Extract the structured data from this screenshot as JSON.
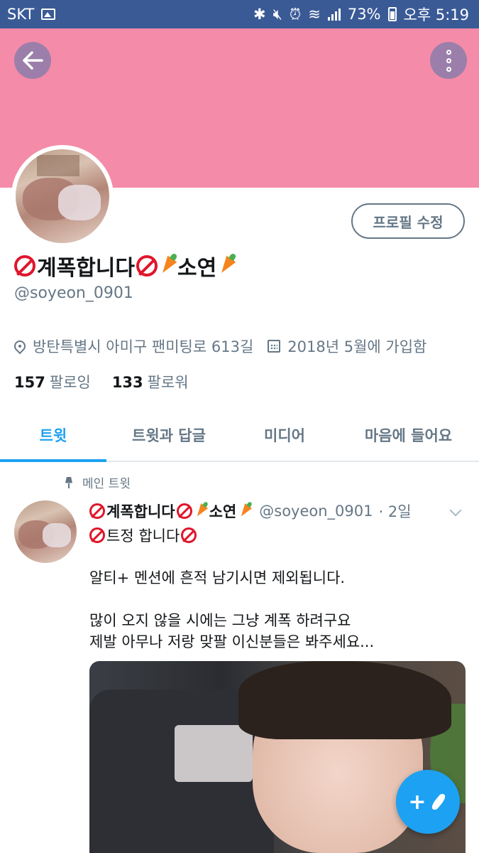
{
  "status_bar": {
    "carrier": "SKT",
    "battery": "73%",
    "time": "오후 5:19"
  },
  "header": {
    "back_icon": "arrow-left-icon",
    "more_icon": "more-vertical-icon",
    "banner_color": "#f48ba8",
    "edit_profile_label": "프로필 수정"
  },
  "profile": {
    "name_part1": "계폭합니다",
    "name_part2": "소연",
    "handle": "@soyeon_0901",
    "location": "방탄특별시 아미구 팬미팅로 613길",
    "joined": "2018년 5월에 가입함",
    "following_count": "157",
    "following_label": "팔로잉",
    "followers_count": "133",
    "followers_label": "팔로워"
  },
  "tabs": [
    {
      "label": "트윗",
      "active": true
    },
    {
      "label": "트윗과 답글",
      "active": false
    },
    {
      "label": "미디어",
      "active": false
    },
    {
      "label": "마음에 들어요",
      "active": false
    }
  ],
  "tweet": {
    "pinned_label": "메인 트윗",
    "name_part1": "계폭합니다",
    "name_part2": "소연",
    "handle": "@soyeon_0901",
    "date": "· 2일",
    "title": "트정 합니다",
    "body": "알티+ 멘션에 흔적 남기시면 제외됩니다.\n\n많이 오지 않을 시에는 그냥 계폭 하려구요\n제발 아무나 저랑 맞팔 이신분들은 봐주세요..."
  },
  "fab": {
    "label": "+",
    "icon": "compose-tweet-icon"
  },
  "colors": {
    "accent": "#1da1f2",
    "status_bar": "#3a5a96",
    "muted": "#657786"
  }
}
